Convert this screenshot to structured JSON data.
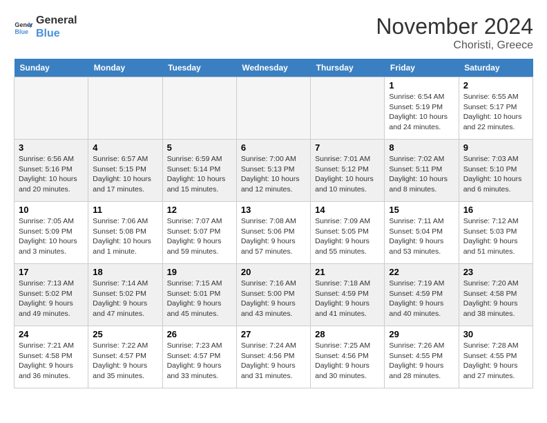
{
  "logo": {
    "line1": "General",
    "line2": "Blue"
  },
  "title": "November 2024",
  "location": "Choristi, Greece",
  "headers": [
    "Sunday",
    "Monday",
    "Tuesday",
    "Wednesday",
    "Thursday",
    "Friday",
    "Saturday"
  ],
  "weeks": [
    [
      {
        "day": "",
        "info": ""
      },
      {
        "day": "",
        "info": ""
      },
      {
        "day": "",
        "info": ""
      },
      {
        "day": "",
        "info": ""
      },
      {
        "day": "",
        "info": ""
      },
      {
        "day": "1",
        "info": "Sunrise: 6:54 AM\nSunset: 5:19 PM\nDaylight: 10 hours\nand 24 minutes."
      },
      {
        "day": "2",
        "info": "Sunrise: 6:55 AM\nSunset: 5:17 PM\nDaylight: 10 hours\nand 22 minutes."
      }
    ],
    [
      {
        "day": "3",
        "info": "Sunrise: 6:56 AM\nSunset: 5:16 PM\nDaylight: 10 hours\nand 20 minutes."
      },
      {
        "day": "4",
        "info": "Sunrise: 6:57 AM\nSunset: 5:15 PM\nDaylight: 10 hours\nand 17 minutes."
      },
      {
        "day": "5",
        "info": "Sunrise: 6:59 AM\nSunset: 5:14 PM\nDaylight: 10 hours\nand 15 minutes."
      },
      {
        "day": "6",
        "info": "Sunrise: 7:00 AM\nSunset: 5:13 PM\nDaylight: 10 hours\nand 12 minutes."
      },
      {
        "day": "7",
        "info": "Sunrise: 7:01 AM\nSunset: 5:12 PM\nDaylight: 10 hours\nand 10 minutes."
      },
      {
        "day": "8",
        "info": "Sunrise: 7:02 AM\nSunset: 5:11 PM\nDaylight: 10 hours\nand 8 minutes."
      },
      {
        "day": "9",
        "info": "Sunrise: 7:03 AM\nSunset: 5:10 PM\nDaylight: 10 hours\nand 6 minutes."
      }
    ],
    [
      {
        "day": "10",
        "info": "Sunrise: 7:05 AM\nSunset: 5:09 PM\nDaylight: 10 hours\nand 3 minutes."
      },
      {
        "day": "11",
        "info": "Sunrise: 7:06 AM\nSunset: 5:08 PM\nDaylight: 10 hours\nand 1 minute."
      },
      {
        "day": "12",
        "info": "Sunrise: 7:07 AM\nSunset: 5:07 PM\nDaylight: 9 hours\nand 59 minutes."
      },
      {
        "day": "13",
        "info": "Sunrise: 7:08 AM\nSunset: 5:06 PM\nDaylight: 9 hours\nand 57 minutes."
      },
      {
        "day": "14",
        "info": "Sunrise: 7:09 AM\nSunset: 5:05 PM\nDaylight: 9 hours\nand 55 minutes."
      },
      {
        "day": "15",
        "info": "Sunrise: 7:11 AM\nSunset: 5:04 PM\nDaylight: 9 hours\nand 53 minutes."
      },
      {
        "day": "16",
        "info": "Sunrise: 7:12 AM\nSunset: 5:03 PM\nDaylight: 9 hours\nand 51 minutes."
      }
    ],
    [
      {
        "day": "17",
        "info": "Sunrise: 7:13 AM\nSunset: 5:02 PM\nDaylight: 9 hours\nand 49 minutes."
      },
      {
        "day": "18",
        "info": "Sunrise: 7:14 AM\nSunset: 5:02 PM\nDaylight: 9 hours\nand 47 minutes."
      },
      {
        "day": "19",
        "info": "Sunrise: 7:15 AM\nSunset: 5:01 PM\nDaylight: 9 hours\nand 45 minutes."
      },
      {
        "day": "20",
        "info": "Sunrise: 7:16 AM\nSunset: 5:00 PM\nDaylight: 9 hours\nand 43 minutes."
      },
      {
        "day": "21",
        "info": "Sunrise: 7:18 AM\nSunset: 4:59 PM\nDaylight: 9 hours\nand 41 minutes."
      },
      {
        "day": "22",
        "info": "Sunrise: 7:19 AM\nSunset: 4:59 PM\nDaylight: 9 hours\nand 40 minutes."
      },
      {
        "day": "23",
        "info": "Sunrise: 7:20 AM\nSunset: 4:58 PM\nDaylight: 9 hours\nand 38 minutes."
      }
    ],
    [
      {
        "day": "24",
        "info": "Sunrise: 7:21 AM\nSunset: 4:58 PM\nDaylight: 9 hours\nand 36 minutes."
      },
      {
        "day": "25",
        "info": "Sunrise: 7:22 AM\nSunset: 4:57 PM\nDaylight: 9 hours\nand 35 minutes."
      },
      {
        "day": "26",
        "info": "Sunrise: 7:23 AM\nSunset: 4:57 PM\nDaylight: 9 hours\nand 33 minutes."
      },
      {
        "day": "27",
        "info": "Sunrise: 7:24 AM\nSunset: 4:56 PM\nDaylight: 9 hours\nand 31 minutes."
      },
      {
        "day": "28",
        "info": "Sunrise: 7:25 AM\nSunset: 4:56 PM\nDaylight: 9 hours\nand 30 minutes."
      },
      {
        "day": "29",
        "info": "Sunrise: 7:26 AM\nSunset: 4:55 PM\nDaylight: 9 hours\nand 28 minutes."
      },
      {
        "day": "30",
        "info": "Sunrise: 7:28 AM\nSunset: 4:55 PM\nDaylight: 9 hours\nand 27 minutes."
      }
    ]
  ]
}
